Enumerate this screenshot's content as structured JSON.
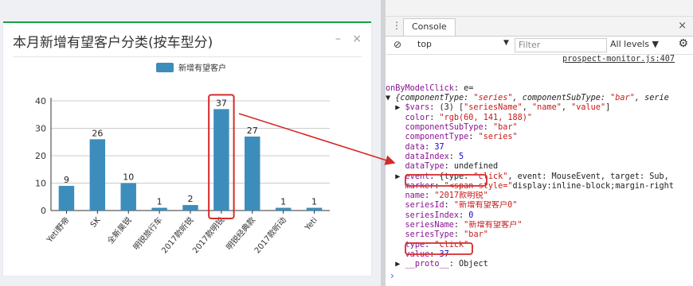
{
  "panel": {
    "title": "本月新增有望客户分类(按车型分)",
    "minimize": "–",
    "close": "×"
  },
  "chart_data": {
    "type": "bar",
    "title": "",
    "legend": [
      "新增有望客户"
    ],
    "legend_position": "top-center",
    "categories": [
      "Yeti野帝",
      "SK",
      "全新昊锐",
      "明锐旅行车",
      "2017款昕锐",
      "2017款明锐",
      "明锐经典款",
      "2017款昕动",
      "Yeti"
    ],
    "series": [
      {
        "name": "新增有望客户",
        "values": [
          9,
          26,
          10,
          1,
          2,
          37,
          27,
          1,
          1
        ],
        "color": "#3c8dbc"
      }
    ],
    "ylim": [
      0,
      40
    ],
    "yticks": [
      0,
      10,
      20,
      30,
      40
    ],
    "grid": true,
    "highlighted_category": "2017款明锐"
  },
  "devtools": {
    "menu_icon": "⋮",
    "tab": "Console",
    "close": "×",
    "context": "top",
    "filter_placeholder": "Filter",
    "levels": "All levels ▼",
    "gear_icon": "⚙",
    "source": "prospect-monitor.js:407",
    "lines": [
      "onByModelClick: e=",
      "▼ {componentType: \"series\", componentSubType: \"bar\", serie",
      "  ▶ $vars: (3) [\"seriesName\", \"name\", \"value\"]",
      "    color: \"rgb(60, 141, 188)\"",
      "    componentSubType: \"bar\"",
      "    componentType: \"series\"",
      "    data: 37",
      "    dataIndex: 5",
      "    dataType: undefined",
      "  ▶ event: {type: \"click\", event: MouseEvent, target: Sub,",
      "    marker: \"<span style=\"display:inline-block;margin-right",
      "    name: \"2017款明锐\"",
      "    seriesId: \"新增有望客户0\"",
      "    seriesIndex: 0",
      "    seriesName: \"新增有望客户\"",
      "    seriesType: \"bar\"",
      "    type: \"click\"",
      "    value: 37",
      "  ▶ __proto__: Object"
    ],
    "prompt": "›"
  }
}
